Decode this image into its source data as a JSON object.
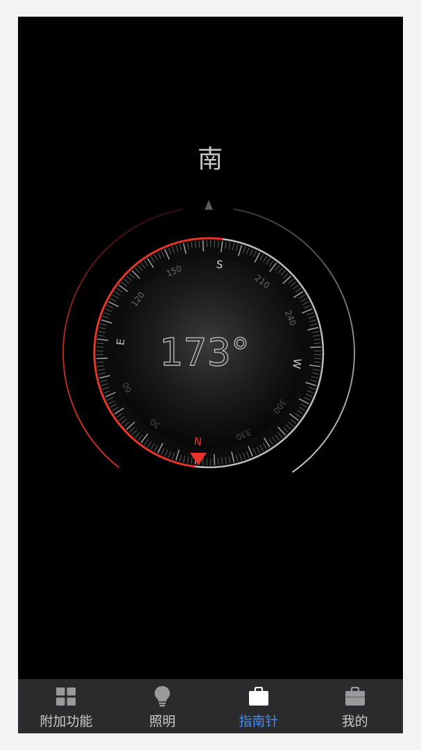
{
  "compass": {
    "direction_label": "南",
    "heading_degrees": 173,
    "heading_text": "173°",
    "cardinals": {
      "north": "N",
      "south": "S",
      "east": "E",
      "west": "W"
    },
    "bezel_numbers": [
      "30",
      "60",
      "120",
      "150",
      "210",
      "240",
      "300",
      "330"
    ],
    "accent_color": "#e8352a",
    "ring_color": "#bdbdbd"
  },
  "tabbar": {
    "active_index": 2,
    "items": [
      {
        "label": "附加功能",
        "icon": "grid-icon"
      },
      {
        "label": "照明",
        "icon": "lightbulb-icon"
      },
      {
        "label": "指南针",
        "icon": "briefcase-icon"
      },
      {
        "label": "我的",
        "icon": "profile-case-icon"
      }
    ],
    "active_color": "#3f8ef2",
    "inactive_color": "#c9c9c9"
  }
}
